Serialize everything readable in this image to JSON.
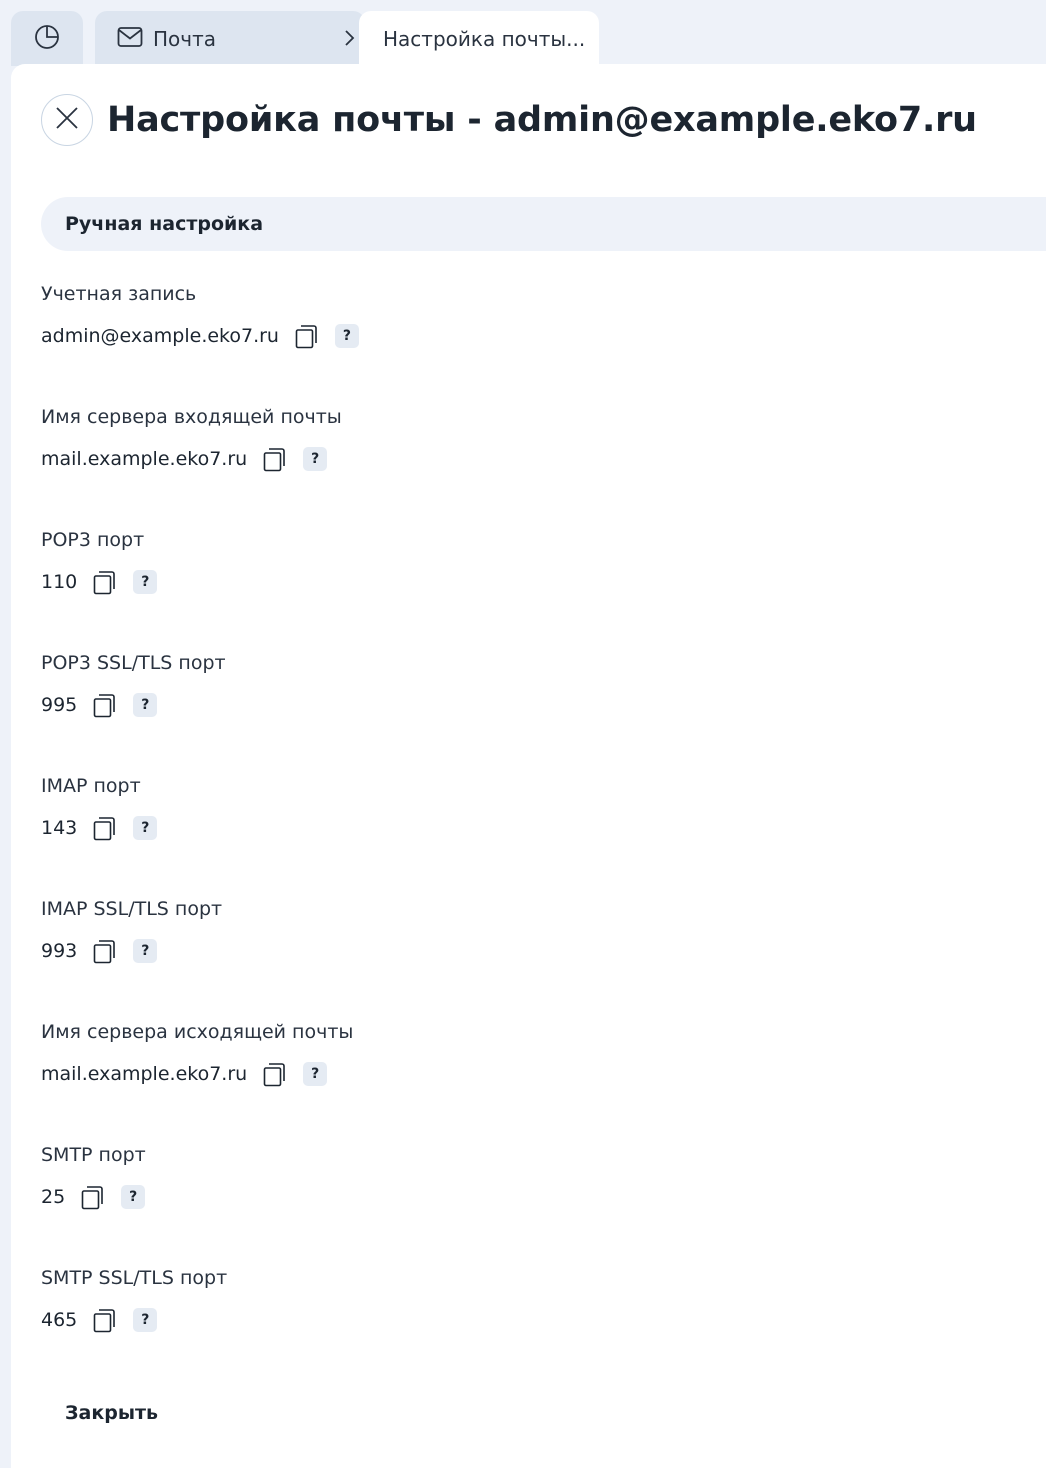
{
  "tabs": {
    "home_icon": "pie-chart-icon",
    "mail_label": "Почта",
    "mail_icon": "envelope-icon",
    "active_label": "Настройка почты..."
  },
  "header": {
    "title": "Настройка почты - admin@example.eko7.ru",
    "close_icon": "close-icon"
  },
  "section": {
    "title": "Ручная настройка"
  },
  "fields": [
    {
      "label": "Учетная запись",
      "value": "admin@example.eko7.ru"
    },
    {
      "label": "Имя сервера входящей почты",
      "value": "mail.example.eko7.ru"
    },
    {
      "label": "POP3 порт",
      "value": "110"
    },
    {
      "label": "POP3 SSL/TLS порт",
      "value": "995"
    },
    {
      "label": "IMAP порт",
      "value": "143"
    },
    {
      "label": "IMAP SSL/TLS порт",
      "value": "993"
    },
    {
      "label": "Имя сервера исходящей почты",
      "value": "mail.example.eko7.ru"
    },
    {
      "label": "SMTP порт",
      "value": "25"
    },
    {
      "label": "SMTP SSL/TLS порт",
      "value": "465"
    }
  ],
  "field_actions": {
    "copy_icon": "copy-icon",
    "help_label": "?"
  },
  "footer": {
    "close_label": "Закрыть"
  },
  "colors": {
    "background": "#eef2f9",
    "tab_inactive": "#dde5f0",
    "panel": "#ffffff",
    "text": "#1c2530"
  }
}
